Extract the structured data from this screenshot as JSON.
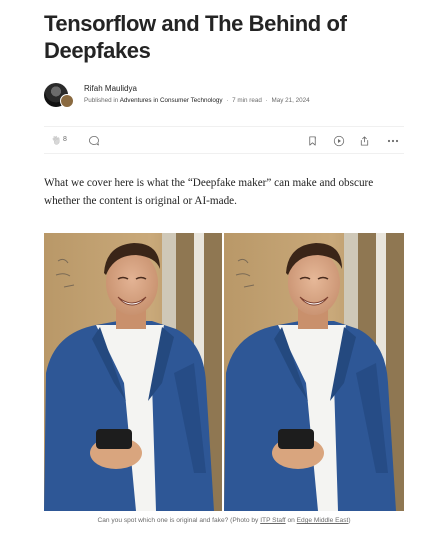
{
  "article": {
    "title": "Tensorflow and The Behind of Deepfakes",
    "intro": "What we cover here is what the “Deepfake maker” can make and obscure whether the content is original or AI-made."
  },
  "author": {
    "name": "Rifah Maulidya",
    "published_in_prefix": "Published in",
    "publication": "Adventures in Consumer Technology",
    "read_time": "7 min read",
    "date": "May 21, 2024",
    "separator": "·"
  },
  "actions": {
    "clap_count": "8",
    "icons": [
      "clap-icon",
      "response-icon",
      "save-bookmark-icon",
      "listen-play-icon",
      "share-icon",
      "more-options-icon"
    ]
  },
  "figure": {
    "caption_prefix": "Can you spot which one is original and fake? (Photo by",
    "credit_1": "ITP Staff",
    "caption_on": "on",
    "credit_2": "Edge Middle East",
    "caption_suffix": ")"
  },
  "colors": {
    "text": "#242424",
    "muted": "#6b6b6b",
    "blazer": "#2f5a98",
    "background": "#ffffff"
  }
}
